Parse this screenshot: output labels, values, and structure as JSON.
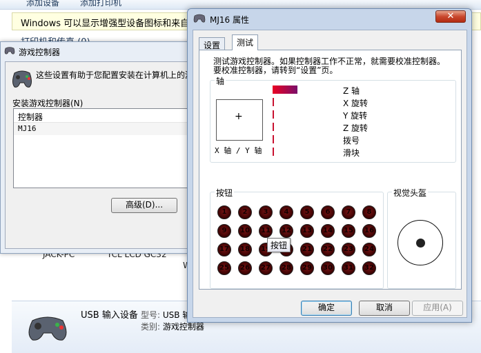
{
  "background_window": {
    "toolbar": {
      "add_device": "添加设备",
      "add_printer": "添加打印机"
    },
    "info_bar": "Windows 可以显示增强型设备图标和来自 Internet 的信息。",
    "group_header": "打印机和传真 (0)",
    "devices": [
      "JACK-PC",
      "TCL LCD GC32",
      "W"
    ],
    "details": {
      "name": "USB 输入设备",
      "model_key": "型号:",
      "model_value": "USB 输入设备",
      "category_key": "类别:",
      "category_value": "游戏控制器"
    }
  },
  "game_controllers": {
    "title": "游戏控制器",
    "description": "这些设置有助于您配置安装在计算机上的游戏控制器",
    "installed_label": "安装游戏控制器(N)",
    "list_header": "控制器",
    "controllers": [
      "MJ16"
    ],
    "advanced_button": "高级(D)..."
  },
  "mj16": {
    "title": "MJ16 属性",
    "close": "✕",
    "tabs": {
      "settings": "设置",
      "test": "测试"
    },
    "test_desc": "测试游戏控制器。如果控制器工作不正常，就需要校准控制器。要校准控制器，请转到“设置”页。",
    "axes": {
      "title": "轴",
      "xy_label": "X 轴 / Y 轴",
      "rows": [
        {
          "name": "Z 轴",
          "fill": 0.3
        },
        {
          "name": "X 旋转",
          "fill": 0
        },
        {
          "name": "Y 旋转",
          "fill": 0
        },
        {
          "name": "Z 旋转",
          "fill": 0
        },
        {
          "name": "拨号",
          "fill": 0
        },
        {
          "name": "滑块",
          "fill": 0
        }
      ]
    },
    "buttons_title": "按钮",
    "buttons": [
      "1",
      "2",
      "3",
      "4",
      "5",
      "6",
      "7",
      "8",
      "9",
      "10",
      "11",
      "12",
      "13",
      "14",
      "15",
      "16",
      "17",
      "18",
      "19",
      "20",
      "21",
      "22",
      "23",
      "24",
      "25",
      "26",
      "27",
      "28",
      "29",
      "30",
      "31",
      "32"
    ],
    "tooltip": "按钮",
    "pov_title": "视觉头盔",
    "ok": "确定",
    "cancel": "取消",
    "apply": "应用(A)"
  }
}
